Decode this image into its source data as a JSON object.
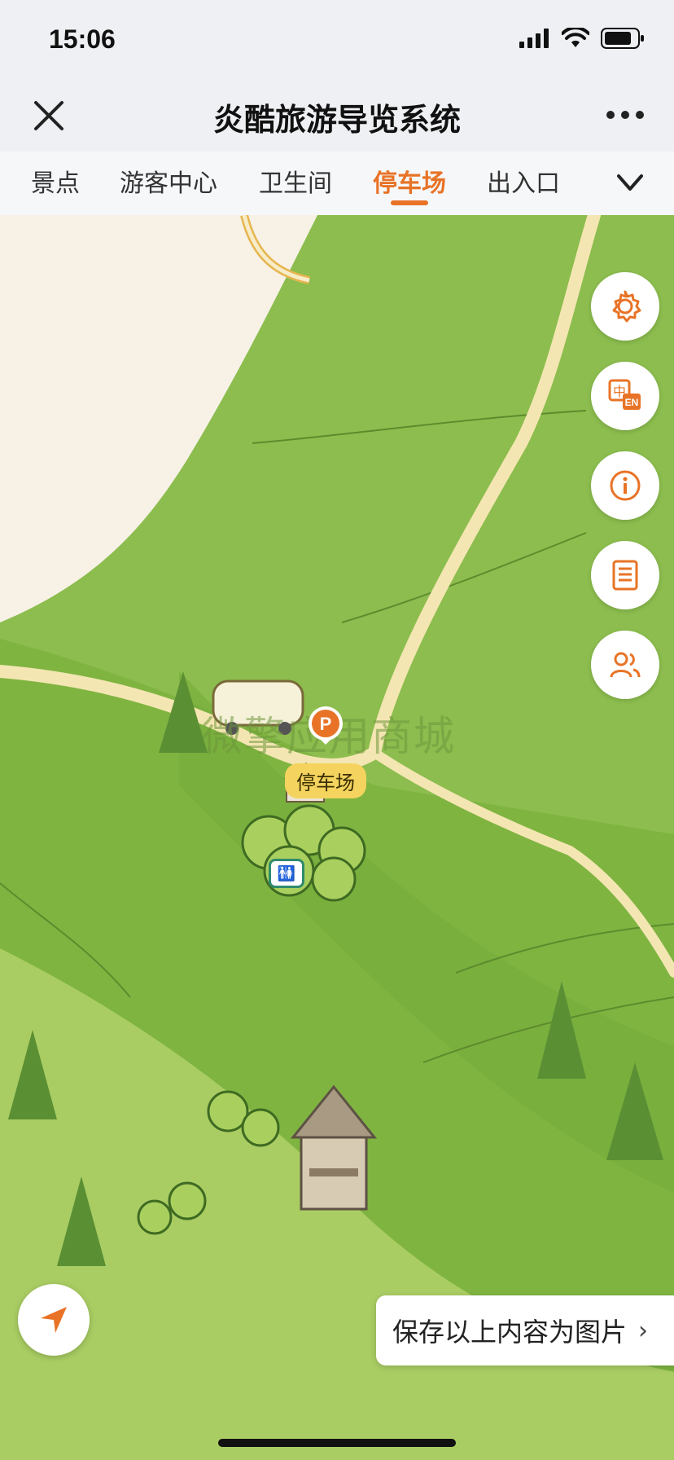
{
  "status": {
    "time": "15:06"
  },
  "nav": {
    "title": "炎酷旅游导览系统"
  },
  "tabs": [
    {
      "label": "景点",
      "active": false
    },
    {
      "label": "游客中心",
      "active": false
    },
    {
      "label": "卫生间",
      "active": false
    },
    {
      "label": "停车场",
      "active": true
    },
    {
      "label": "出入口",
      "active": false
    }
  ],
  "map": {
    "poi_label": "停车场",
    "watermark": "微擎应用商城",
    "wc_label": "🚻"
  },
  "side_buttons": [
    {
      "icon": "gear-icon"
    },
    {
      "icon": "language-switch-icon",
      "text_cn": "中",
      "text_en": "EN"
    },
    {
      "icon": "info-icon"
    },
    {
      "icon": "notice-icon"
    },
    {
      "icon": "group-icon"
    }
  ],
  "save_banner": {
    "label": "保存以上内容为图片",
    "chevron": "›"
  },
  "colors": {
    "accent": "#e87326",
    "map_green": "#7fb441",
    "road": "#f4e6b2"
  }
}
